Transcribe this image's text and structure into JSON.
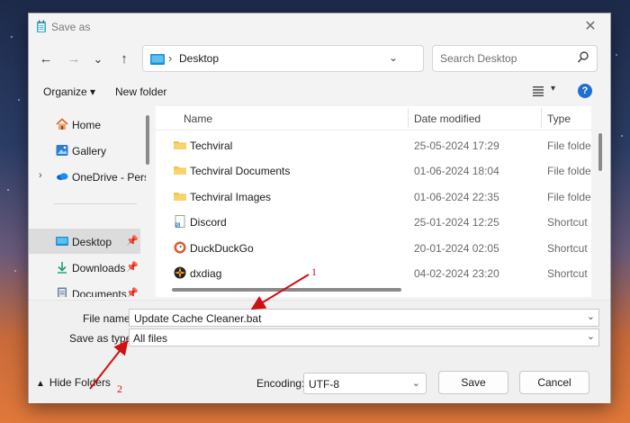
{
  "window": {
    "title": "Save as",
    "close_label": "✕"
  },
  "nav": {
    "back": "←",
    "forward": "→",
    "recent": "⌄",
    "up": "↑",
    "path_separator": "›",
    "path_current": "Desktop",
    "path_dropdown": "⌄",
    "refresh": "⟳",
    "search_placeholder": "Search Desktop"
  },
  "commands": {
    "organize": "Organize ▾",
    "new_folder": "New folder",
    "help": "?",
    "view_dropdown": "▾"
  },
  "sidebar": {
    "items": [
      {
        "label": "Home",
        "icon": "home-icon"
      },
      {
        "label": "Gallery",
        "icon": "gallery-icon"
      },
      {
        "label": "OneDrive - Perso",
        "icon": "onedrive-icon",
        "expand": "›"
      },
      {
        "label": "Desktop",
        "icon": "desktop-icon",
        "pin": "📌",
        "selected": true
      },
      {
        "label": "Downloads",
        "icon": "downloads-icon",
        "pin": "📌"
      },
      {
        "label": "Documents",
        "icon": "documents-icon",
        "pin": "📌"
      }
    ]
  },
  "file_list": {
    "columns": {
      "name": "Name",
      "date": "Date modified",
      "type": "Type"
    },
    "rows": [
      {
        "name": "Techviral",
        "date": "25-05-2024 17:29",
        "type": "File folder",
        "icon": "folder-icon"
      },
      {
        "name": "Techviral Documents",
        "date": "01-06-2024 18:04",
        "type": "File folder",
        "icon": "folder-icon"
      },
      {
        "name": "Techviral Images",
        "date": "01-06-2024 22:35",
        "type": "File folder",
        "icon": "folder-icon"
      },
      {
        "name": "Discord",
        "date": "25-01-2024 12:25",
        "type": "Shortcut",
        "icon": "shortcut-icon"
      },
      {
        "name": "DuckDuckGo",
        "date": "20-01-2024 02:05",
        "type": "Shortcut",
        "icon": "duckduckgo-icon"
      },
      {
        "name": "dxdiag",
        "date": "04-02-2024 23:20",
        "type": "Shortcut",
        "icon": "dxdiag-icon"
      }
    ]
  },
  "form": {
    "file_name_label": "File name:",
    "file_name_value": "Update Cache Cleaner.bat",
    "save_type_label": "Save as type:",
    "save_type_value": "All files"
  },
  "footer": {
    "hide_folders": "Hide Folders",
    "hide_caret": "▲",
    "encoding_label": "Encoding:",
    "encoding_value": "UTF-8",
    "save": "Save",
    "cancel": "Cancel"
  },
  "annotations": {
    "label_1": "1",
    "label_2": "2",
    "color": "#d01010"
  },
  "colors": {
    "folder": "#f2c24b",
    "accent": "#1f6fd1",
    "selected_bg": "#dcdcdc"
  }
}
